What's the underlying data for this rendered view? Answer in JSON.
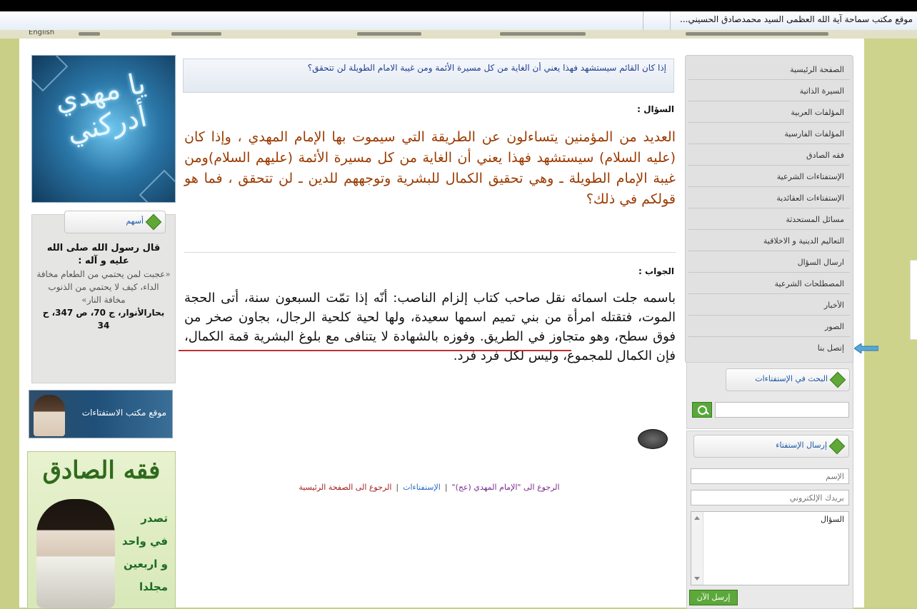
{
  "window": {
    "title": "موقع مكتب سماحة آية الله العظمى السيد محمدصادق الحسيني..."
  },
  "menubar": {
    "english_label": "English"
  },
  "left_column": {
    "banner_top_calligraphy": "يا مهدي أدركني",
    "hadith_box": {
      "tab_label": "أسهم",
      "header": "قال رسول الله صلى الله عليه و آله :",
      "body": "«عجبت لمن يحتمي من الطعام مخافة الداء، كيف لا يحتمي من الذنوب مخافة النار»",
      "source": "بحارالأنوار، ج 70، ص 347، ح 34"
    },
    "istiftaat_banner_label": "موقع مكتب الاستفتاءات",
    "fiqh_banner": {
      "title": "فقه الصادق",
      "lines": [
        "تصدر",
        "في واحد",
        "و اربعين",
        "مجلدا"
      ]
    }
  },
  "content": {
    "quote": "إذا كان القائم سيستشهد فهذا يعني أن الغاية من كل مسيرة الأئمة ومن غيبة الامام الطويلة لن تتحقق؟",
    "question_label": "السؤال :",
    "question_text": "العديد من المؤمنين يتساءلون عن الطريقة التي سيموت بها الإمام المهدي ، وإذا كان (عليه السلام) سيستشهد فهذا يعني أن الغاية من كل مسيرة الأئمة (عليهم السلام)ومن غيبة الإمام الطويلة ـ وهي تحقيق الكمال للبشرية وتوجههم للدين ـ لن تتحقق ، فما هو قولكم في ذلك؟",
    "answer_label": "الجواب :",
    "answer_text": "باسمه جلت اسمائه نقل صاحب كتاب إلزام الناصب: أنّه إذا تمّت السبعون سنة، أتى الحجة الموت، فتقتله امرأة من بني تميم اسمها سعيدة، ولها لحية كلحية الرجال، بجاون صخر من فوق سطح، وهو متجاوز في الطريق. وفوزه بالشهادة لا يتنافى مع بلوغ البشرية قمة الكمال، فإن الكمال للمجموع، وليس لكل فرد فرد.",
    "bottom_links": {
      "link1": "الرجوع الى \"الإمام المهدي (عج)\"",
      "link2": "الإستفتاءات",
      "link3": "الرجوع الى الصفحة الرئيسية",
      "separator": "|"
    }
  },
  "nav": {
    "items": [
      "الصفحة الرئيسية",
      "السيرة الذاتية",
      "المؤلفات العربية",
      "المؤلفات الفارسية",
      "فقه الصادق",
      "الإستفتاءات الشرعية",
      "الإستفتاءات العقائدية",
      "مسائل المستحدثة",
      "التعاليم الدينية و الاخلاقية",
      "ارسال السؤال",
      "المصطلحات الشرعية",
      "الأخبار",
      "الصور",
      "إتصل بنا"
    ]
  },
  "search": {
    "tab_label": "البحث في الإستفتاءات",
    "placeholder": ""
  },
  "ask": {
    "tab_label": "إرسال الإستفتاء",
    "name_placeholder": "الإسم",
    "email_placeholder": "بريدك الإلكتروني",
    "question_placeholder": "السؤال",
    "send_label": "إرسل الآن"
  },
  "colors": {
    "question_text": "#9b3a00",
    "quote_text": "#23408f",
    "accent_green": "#5ca83a",
    "outer_background": "#c9cf86"
  },
  "icons": {
    "box_tab": "green-diamond-icon",
    "search": "search-icon",
    "pointer": "arrow-pointer-icon"
  }
}
